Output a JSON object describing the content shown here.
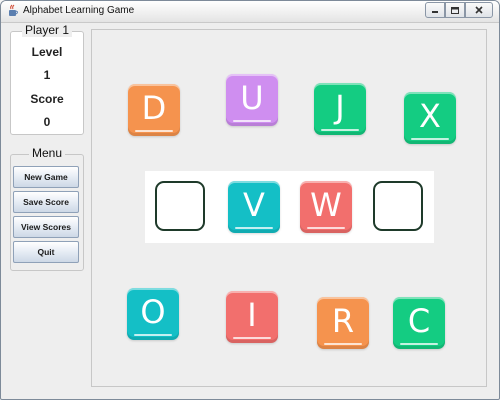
{
  "window": {
    "title": "Alphabet Learning Game"
  },
  "player_panel": {
    "title": "Player 1",
    "level_label": "Level",
    "level_value": "1",
    "score_label": "Score",
    "score_value": "0"
  },
  "menu_panel": {
    "title": "Menu",
    "buttons": [
      "New Game",
      "Save Score",
      "View Scores",
      "Quit"
    ]
  },
  "colors": {
    "orange": "#f5934e",
    "purple": "#cf8ef0",
    "green": "#14cc82",
    "cyan": "#14bfc6",
    "red": "#f26f6d"
  },
  "board": {
    "tiles": [
      {
        "letter": "D",
        "color": "orange"
      },
      {
        "letter": "U",
        "color": "purple"
      },
      {
        "letter": "J",
        "color": "green"
      },
      {
        "letter": "X",
        "color": "green"
      },
      {
        "letter": "O",
        "color": "cyan"
      },
      {
        "letter": "I",
        "color": "red"
      },
      {
        "letter": "R",
        "color": "orange"
      },
      {
        "letter": "C",
        "color": "green"
      }
    ],
    "slots": [
      {
        "letter": "",
        "color": ""
      },
      {
        "letter": "V",
        "color": "cyan"
      },
      {
        "letter": "W",
        "color": "red"
      },
      {
        "letter": "",
        "color": ""
      }
    ]
  }
}
